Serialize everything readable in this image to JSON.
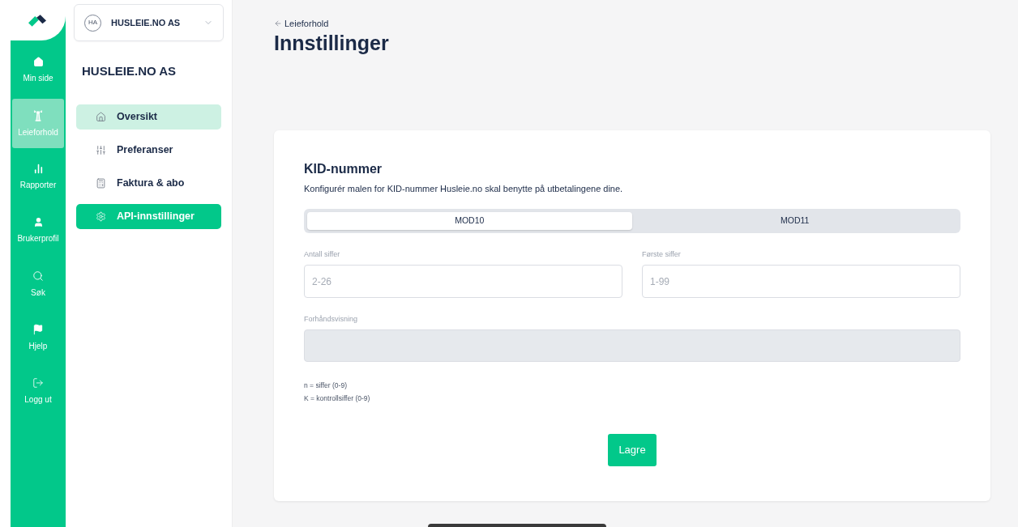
{
  "nav_rail": {
    "items": [
      {
        "label": "Min side",
        "selected": false
      },
      {
        "label": "Leieforhold",
        "selected": true
      },
      {
        "label": "Rapporter",
        "selected": false
      },
      {
        "label": "Brukerprofil",
        "selected": false
      },
      {
        "label": "Søk",
        "selected": false
      },
      {
        "label": "Hjelp",
        "selected": false
      },
      {
        "label": "Logg ut",
        "selected": false
      }
    ]
  },
  "org_switcher": {
    "initials": "HA",
    "name": "HUSLEIE.NO AS"
  },
  "sidebar": {
    "title": "HUSLEIE.NO AS",
    "items": [
      {
        "label": "Oversikt",
        "selected": false,
        "hovered": true
      },
      {
        "label": "Preferanser",
        "selected": false,
        "hovered": false
      },
      {
        "label": "Faktura & abo",
        "selected": false,
        "hovered": false
      },
      {
        "label": "API-innstillinger",
        "selected": true,
        "hovered": false
      }
    ]
  },
  "breadcrumb": {
    "label": "Leieforhold"
  },
  "page_title": "Innstillinger",
  "kid_card": {
    "title": "KID-nummer",
    "description": "Konfigurér malen for KID-nummer Husleie.no skal benytte på utbetalingene dine.",
    "tabs": [
      {
        "label": "MOD10",
        "selected": true
      },
      {
        "label": "MOD11",
        "selected": false
      }
    ],
    "fields": [
      {
        "label": "Antall siffer",
        "placeholder": "2-26"
      },
      {
        "label": "Første siffer",
        "placeholder": "1-99"
      }
    ],
    "preview": {
      "label": "Forhåndsvisning"
    },
    "notes": [
      "n = siffer (0-9)",
      "K = kontrollsiffer (0-9)"
    ],
    "save_button": "Lagre"
  }
}
